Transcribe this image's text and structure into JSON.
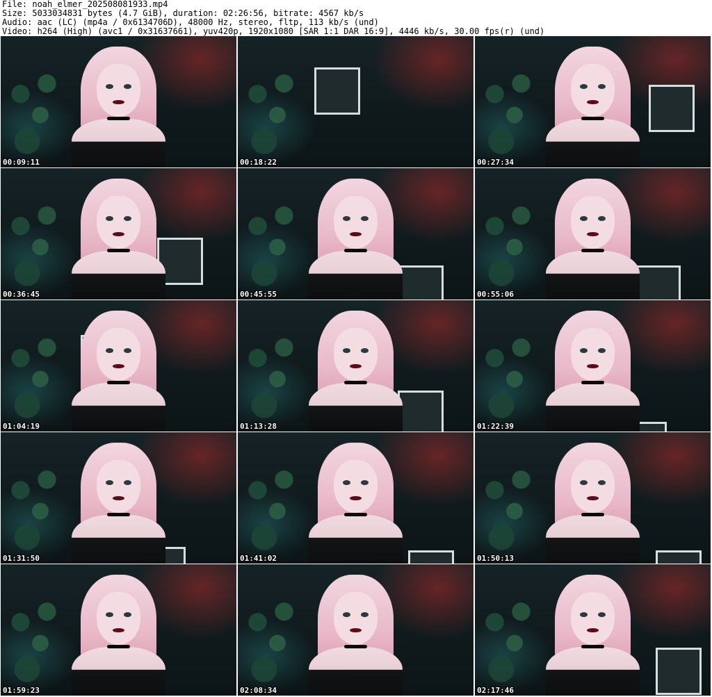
{
  "header": {
    "line1": "File: noah_elmer_202508081933.mp4",
    "line2": "Size: 5033034831 bytes (4.7 GiB), duration: 02:26:56, bitrate: 4567 kb/s",
    "line3": "Audio: aac (LC) (mp4a / 0x6134706D), 48000 Hz, stereo, fltp, 113 kb/s (und)",
    "line4": "Video: h264 (High) (avc1 / 0x31637661), yuv420p, 1920x1080 [SAR 1:1 DAR 16:9], 4446 kb/s, 30.00 fps(r) (und)"
  },
  "thumbnails": [
    {
      "timestamp": "00:09:11"
    },
    {
      "timestamp": "00:18:22"
    },
    {
      "timestamp": "00:27:34"
    },
    {
      "timestamp": "00:36:45"
    },
    {
      "timestamp": "00:45:55"
    },
    {
      "timestamp": "00:55:06"
    },
    {
      "timestamp": "01:04:19"
    },
    {
      "timestamp": "01:13:28"
    },
    {
      "timestamp": "01:22:39"
    },
    {
      "timestamp": "01:31:50"
    },
    {
      "timestamp": "01:41:02"
    },
    {
      "timestamp": "01:50:13"
    },
    {
      "timestamp": "01:59:23"
    },
    {
      "timestamp": "02:08:34"
    },
    {
      "timestamp": "02:17:46"
    }
  ]
}
